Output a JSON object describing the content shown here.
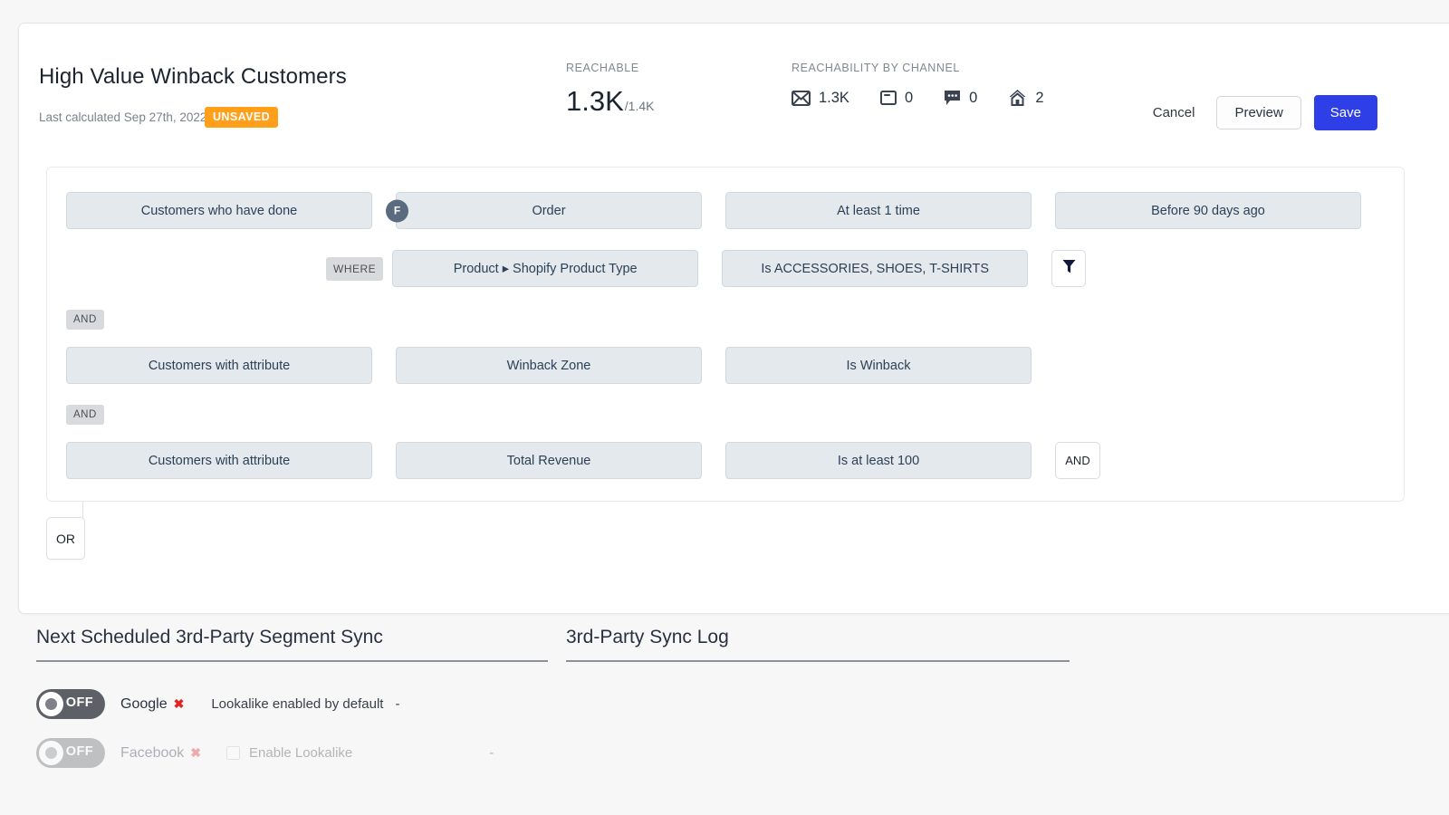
{
  "segment": {
    "title": "High Value Winback Customers",
    "last_calculated": "Last calculated Sep 27th, 2022",
    "status_badge": "UNSAVED"
  },
  "stats": {
    "reachable_label": "REACHABLE",
    "reachable_value": "1.3K",
    "reachable_denominator": "/1.4K",
    "channels_label": "REACHABILITY BY CHANNEL",
    "channels": [
      {
        "icon": "email-icon",
        "value": "1.3K"
      },
      {
        "icon": "push-notification-icon",
        "value": "0"
      },
      {
        "icon": "sms-chat-icon",
        "value": "0"
      },
      {
        "icon": "direct-mail-home-icon",
        "value": "2"
      }
    ]
  },
  "actions": {
    "cancel": "Cancel",
    "preview": "Preview",
    "save": "Save",
    "save_color": "#2f3fe8"
  },
  "query": {
    "rows": [
      {
        "subject": "Customers who have done",
        "badge": "F",
        "event": "Order",
        "frequency": "At least 1 time",
        "timeframe": "Before 90 days ago"
      },
      {
        "where_tag": "WHERE",
        "attribute": "Product ▸ Shopify Product Type",
        "operator": "Is ACCESSORIES, SHOES, T-SHIRTS",
        "filter_icon": "funnel-filter-icon"
      },
      {
        "connector": "AND",
        "subject": "Customers with attribute",
        "attribute": "Winback Zone",
        "operator": "Is Winback"
      },
      {
        "connector": "AND",
        "subject": "Customers with attribute",
        "attribute": "Total Revenue",
        "operator": "Is at least 100",
        "group_operator": "AND"
      }
    ],
    "or_button": "OR"
  },
  "sync": {
    "schedule_heading": "Next Scheduled 3rd-Party Segment Sync",
    "log_heading": "3rd-Party Sync Log",
    "providers": [
      {
        "toggle_state": "OFF",
        "name": "Google",
        "status_mark": "✖",
        "note": "Lookalike enabled by default",
        "dash": "-"
      },
      {
        "toggle_state": "OFF",
        "name": "Facebook",
        "status_mark": "✖",
        "checkbox_label": "Enable Lookalike",
        "dash": "-"
      }
    ]
  }
}
